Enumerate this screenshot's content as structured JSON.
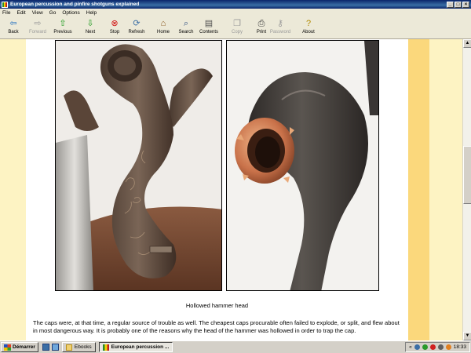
{
  "window": {
    "title": "European percussion and pinfire shotguns explained",
    "min_glyph": "_",
    "max_glyph": "□",
    "close_glyph": "×"
  },
  "menu": [
    "File",
    "Edit",
    "View",
    "Go",
    "Options",
    "Help"
  ],
  "toolbar": [
    {
      "label": "Back",
      "icon": "back-arrow-icon",
      "glyph": "⇦",
      "color": "#1e6ebf",
      "enabled": true
    },
    {
      "label": "Forward",
      "icon": "forward-arrow-icon",
      "glyph": "⇨",
      "color": "#9a9a9a",
      "enabled": false
    },
    {
      "label": "Previous",
      "icon": "up-arrow-icon",
      "glyph": "⇧",
      "color": "#1f9a1f",
      "enabled": true
    },
    {
      "label": "Next",
      "icon": "down-arrow-icon",
      "glyph": "⇩",
      "color": "#1f9a1f",
      "enabled": true
    },
    {
      "label": "Stop",
      "icon": "stop-icon",
      "glyph": "⊗",
      "color": "#d01010",
      "enabled": true
    },
    {
      "label": "Refresh",
      "icon": "refresh-icon",
      "glyph": "⟳",
      "color": "#3a6ea5",
      "enabled": true
    },
    {
      "label": "Home",
      "icon": "home-icon",
      "glyph": "⌂",
      "color": "#8a5a20",
      "enabled": true
    },
    {
      "label": "Search",
      "icon": "search-icon",
      "glyph": "⌕",
      "color": "#305080",
      "enabled": true
    },
    {
      "label": "Contents",
      "icon": "contents-icon",
      "glyph": "▤",
      "color": "#505050",
      "enabled": true
    },
    {
      "label": "Copy",
      "icon": "copy-icon",
      "glyph": "❐",
      "color": "#9a9a9a",
      "enabled": false
    },
    {
      "label": "Print",
      "icon": "printer-icon",
      "glyph": "⎙",
      "color": "#404040",
      "enabled": true
    },
    {
      "label": "Password",
      "icon": "key-icon",
      "glyph": "⚷",
      "color": "#9a9a9a",
      "enabled": false
    },
    {
      "label": "About",
      "icon": "about-icon",
      "glyph": "?",
      "color": "#b08a00",
      "enabled": true
    }
  ],
  "content": {
    "caption": "Hollowed hammer head",
    "paragraph": "The caps were, at that time, a regular source of trouble as well. The cheapest caps procurable often failed to explode, or split, and flew about in most dangerous way. It is probably one of the reasons why the head of the hammer was hollowed in order to trap the cap."
  },
  "taskbar": {
    "start_label": "Démarrer",
    "tasks": [
      {
        "label": "Ebooks",
        "icon": "folder-icon",
        "active": false
      },
      {
        "label": "European percussion ...",
        "icon": "ebook-app-icon",
        "active": true
      }
    ],
    "tray_expand": "«",
    "clock": "18:33"
  },
  "colors": {
    "page_bg": "#fdf3c3",
    "gold_strip": "#fbd87c",
    "titlebar": "#0a246a"
  }
}
